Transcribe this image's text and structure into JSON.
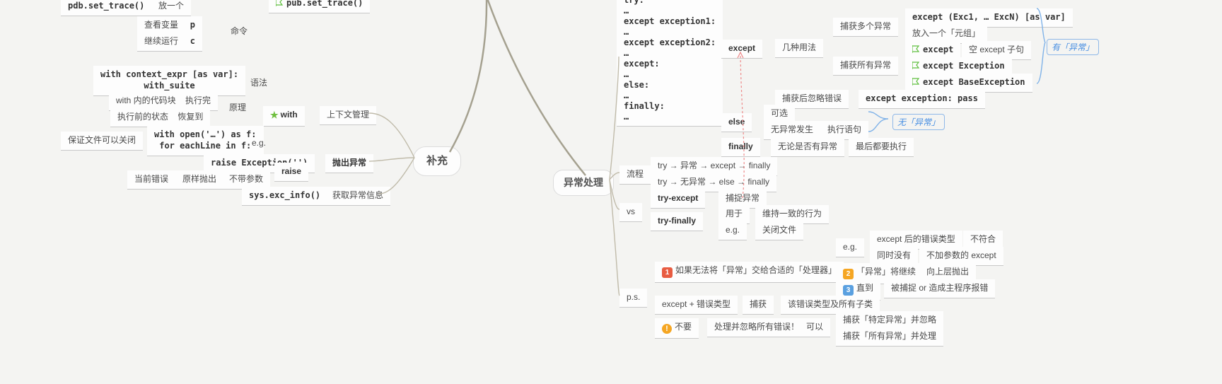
{
  "left": {
    "pdb_set_trace": "pdb.set_trace()",
    "pdb_set_trace2": "pub.set_trace()",
    "place_one": "放一个",
    "view_var": "查看变量",
    "p": "p",
    "continue_run": "继续运行",
    "c": "c",
    "command": "命令",
    "with_header1": "with context_expr [as var]:",
    "with_header2": "with_suite",
    "syntax": "语法",
    "with_code_block": "with 内的代码块",
    "exec_done": "执行完",
    "restore_to": "恢复到",
    "state_before_exec": "执行前的状态",
    "principle": "原理",
    "with": "with",
    "ctx_mgr": "上下文管理",
    "with_open": "with open('…') as f:",
    "for_each_line": "for eachLine in f:",
    "ensure_close": "保证文件可以关闭",
    "eg": "e.g.",
    "raise_exception": "raise Exception('')",
    "current_error": "当前错误",
    "throw_as_is": "原样抛出",
    "no_args": "不带参数",
    "raise": "raise",
    "throw_exc": "抛出异常",
    "sys_exc_info": "sys.exc_info()",
    "get_exc_info": "获取异常信息",
    "supplement": "补充"
  },
  "right": {
    "try_block": [
      "try:",
      "…",
      "except exception1:",
      "…",
      "except exception2:",
      "…",
      "except:",
      "…",
      "else:",
      "…",
      "finally:",
      "…"
    ],
    "except": "except",
    "usages": "几种用法",
    "catch_multi": "捕获多个异常",
    "except_tuple": "except (Exc1, … ExcN) [as var]",
    "put_tuple": "放入一个「元组」",
    "except_plain": "except",
    "empty_clause": "空 except 子句",
    "except_exception": "except Exception",
    "except_base": "except BaseException",
    "catch_all": "捕获所有异常",
    "catch_ignore": "捕获后忽略错误",
    "except_pass": "except exception: pass",
    "else": "else",
    "optional": "可选",
    "no_exc": "无异常发生",
    "exec_stmt": "执行语句",
    "finally": "finally",
    "whether_exc": "无论是否有异常",
    "always_exec": "最后都要执行",
    "has_exc_label": "有「异常」",
    "no_exc_label": "无「异常」",
    "exc_handling": "异常处理",
    "flow": "流程",
    "flow1": "try → 异常 → except → finally",
    "flow2": "try → 无异常 → else → finally",
    "vs": "vs",
    "try_except": "try-except",
    "catch_exc": "捕捉异常",
    "try_finally": "try-finally",
    "used_for": "用于",
    "keep_consistent": "维持一致的行为",
    "eg": "e.g.",
    "close_file": "关闭文件",
    "ps": "p.s.",
    "ps_row1": "如果无法将「异常」交给合适的「处理器」",
    "ps_eg": "e.g.",
    "ps_err_after": "except 后的错误类型",
    "ps_not_match": "不符合",
    "ps_also_none": "同时没有",
    "ps_no_arg_except": "不加参数的 except",
    "ps_exc_continue": "「异常」将继续",
    "ps_throw_up": "向上层抛出",
    "ps_until": "直到",
    "ps_caught_or_crash": "被捕捉 or 造成主程序报错",
    "ps_row2_l": "except + 错误类型",
    "ps_row2_m": "捕获",
    "ps_row2_r": "该错误类型及所有子类",
    "ps_row3_dont": "不要",
    "ps_row3_handle": "处理并忽略所有错误！",
    "ps_row3_can": "可以",
    "ps_row3_c1": "捕获「特定异常」并忽略",
    "ps_row3_c2": "捕获「所有异常」并处理"
  }
}
